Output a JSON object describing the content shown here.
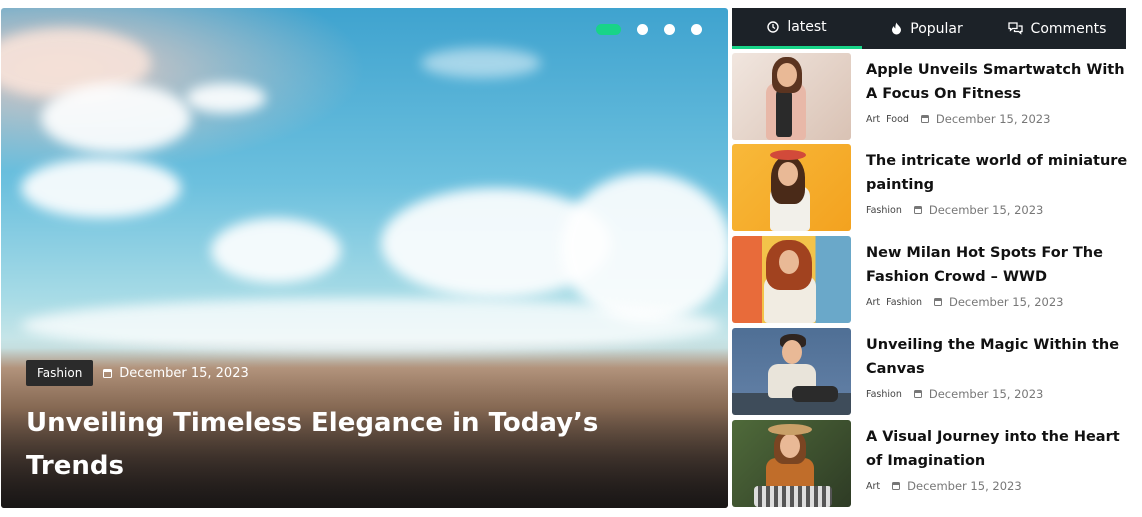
{
  "hero": {
    "category": "Fashion",
    "date": "December 15, 2023",
    "title": "Unveiling Timeless Elegance in Today’s Trends",
    "slides": 4,
    "active_slide": 1
  },
  "tabs": [
    {
      "label": "latest",
      "icon": "clock-icon",
      "active": true
    },
    {
      "label": "Popular",
      "icon": "fire-icon",
      "active": false
    },
    {
      "label": "Comments",
      "icon": "comments-icon",
      "active": false
    }
  ],
  "posts": [
    {
      "title": "Apple Unveils Smartwatch With A Focus On Fitness",
      "categories": [
        "Art",
        "Food"
      ],
      "date": "December 15, 2023"
    },
    {
      "title": "The intricate world of miniature painting",
      "categories": [
        "Fashion"
      ],
      "date": "December 15, 2023"
    },
    {
      "title": "New Milan Hot Spots For The Fashion Crowd – WWD",
      "categories": [
        "Art",
        "Fashion"
      ],
      "date": "December 15, 2023"
    },
    {
      "title": "Unveiling the Magic Within the Canvas",
      "categories": [
        "Fashion"
      ],
      "date": "December 15, 2023"
    },
    {
      "title": "A Visual Journey into the Heart of Imagination",
      "categories": [
        "Art"
      ],
      "date": "December 15, 2023"
    }
  ],
  "colors": {
    "accent": "#18d488",
    "tab_bar": "#1c2228",
    "badge": "#2b2b2b"
  }
}
